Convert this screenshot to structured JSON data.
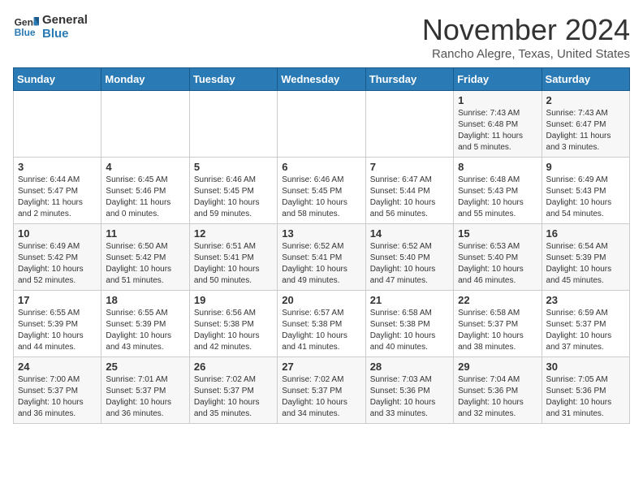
{
  "logo": {
    "line1": "General",
    "line2": "Blue"
  },
  "header": {
    "month": "November 2024",
    "location": "Rancho Alegre, Texas, United States"
  },
  "days_of_week": [
    "Sunday",
    "Monday",
    "Tuesday",
    "Wednesday",
    "Thursday",
    "Friday",
    "Saturday"
  ],
  "weeks": [
    [
      {
        "day": "",
        "info": ""
      },
      {
        "day": "",
        "info": ""
      },
      {
        "day": "",
        "info": ""
      },
      {
        "day": "",
        "info": ""
      },
      {
        "day": "",
        "info": ""
      },
      {
        "day": "1",
        "info": "Sunrise: 7:43 AM\nSunset: 6:48 PM\nDaylight: 11 hours\nand 5 minutes."
      },
      {
        "day": "2",
        "info": "Sunrise: 7:43 AM\nSunset: 6:47 PM\nDaylight: 11 hours\nand 3 minutes."
      }
    ],
    [
      {
        "day": "3",
        "info": "Sunrise: 6:44 AM\nSunset: 5:47 PM\nDaylight: 11 hours\nand 2 minutes."
      },
      {
        "day": "4",
        "info": "Sunrise: 6:45 AM\nSunset: 5:46 PM\nDaylight: 11 hours\nand 0 minutes."
      },
      {
        "day": "5",
        "info": "Sunrise: 6:46 AM\nSunset: 5:45 PM\nDaylight: 10 hours\nand 59 minutes."
      },
      {
        "day": "6",
        "info": "Sunrise: 6:46 AM\nSunset: 5:45 PM\nDaylight: 10 hours\nand 58 minutes."
      },
      {
        "day": "7",
        "info": "Sunrise: 6:47 AM\nSunset: 5:44 PM\nDaylight: 10 hours\nand 56 minutes."
      },
      {
        "day": "8",
        "info": "Sunrise: 6:48 AM\nSunset: 5:43 PM\nDaylight: 10 hours\nand 55 minutes."
      },
      {
        "day": "9",
        "info": "Sunrise: 6:49 AM\nSunset: 5:43 PM\nDaylight: 10 hours\nand 54 minutes."
      }
    ],
    [
      {
        "day": "10",
        "info": "Sunrise: 6:49 AM\nSunset: 5:42 PM\nDaylight: 10 hours\nand 52 minutes."
      },
      {
        "day": "11",
        "info": "Sunrise: 6:50 AM\nSunset: 5:42 PM\nDaylight: 10 hours\nand 51 minutes."
      },
      {
        "day": "12",
        "info": "Sunrise: 6:51 AM\nSunset: 5:41 PM\nDaylight: 10 hours\nand 50 minutes."
      },
      {
        "day": "13",
        "info": "Sunrise: 6:52 AM\nSunset: 5:41 PM\nDaylight: 10 hours\nand 49 minutes."
      },
      {
        "day": "14",
        "info": "Sunrise: 6:52 AM\nSunset: 5:40 PM\nDaylight: 10 hours\nand 47 minutes."
      },
      {
        "day": "15",
        "info": "Sunrise: 6:53 AM\nSunset: 5:40 PM\nDaylight: 10 hours\nand 46 minutes."
      },
      {
        "day": "16",
        "info": "Sunrise: 6:54 AM\nSunset: 5:39 PM\nDaylight: 10 hours\nand 45 minutes."
      }
    ],
    [
      {
        "day": "17",
        "info": "Sunrise: 6:55 AM\nSunset: 5:39 PM\nDaylight: 10 hours\nand 44 minutes."
      },
      {
        "day": "18",
        "info": "Sunrise: 6:55 AM\nSunset: 5:39 PM\nDaylight: 10 hours\nand 43 minutes."
      },
      {
        "day": "19",
        "info": "Sunrise: 6:56 AM\nSunset: 5:38 PM\nDaylight: 10 hours\nand 42 minutes."
      },
      {
        "day": "20",
        "info": "Sunrise: 6:57 AM\nSunset: 5:38 PM\nDaylight: 10 hours\nand 41 minutes."
      },
      {
        "day": "21",
        "info": "Sunrise: 6:58 AM\nSunset: 5:38 PM\nDaylight: 10 hours\nand 40 minutes."
      },
      {
        "day": "22",
        "info": "Sunrise: 6:58 AM\nSunset: 5:37 PM\nDaylight: 10 hours\nand 38 minutes."
      },
      {
        "day": "23",
        "info": "Sunrise: 6:59 AM\nSunset: 5:37 PM\nDaylight: 10 hours\nand 37 minutes."
      }
    ],
    [
      {
        "day": "24",
        "info": "Sunrise: 7:00 AM\nSunset: 5:37 PM\nDaylight: 10 hours\nand 36 minutes."
      },
      {
        "day": "25",
        "info": "Sunrise: 7:01 AM\nSunset: 5:37 PM\nDaylight: 10 hours\nand 36 minutes."
      },
      {
        "day": "26",
        "info": "Sunrise: 7:02 AM\nSunset: 5:37 PM\nDaylight: 10 hours\nand 35 minutes."
      },
      {
        "day": "27",
        "info": "Sunrise: 7:02 AM\nSunset: 5:37 PM\nDaylight: 10 hours\nand 34 minutes."
      },
      {
        "day": "28",
        "info": "Sunrise: 7:03 AM\nSunset: 5:36 PM\nDaylight: 10 hours\nand 33 minutes."
      },
      {
        "day": "29",
        "info": "Sunrise: 7:04 AM\nSunset: 5:36 PM\nDaylight: 10 hours\nand 32 minutes."
      },
      {
        "day": "30",
        "info": "Sunrise: 7:05 AM\nSunset: 5:36 PM\nDaylight: 10 hours\nand 31 minutes."
      }
    ]
  ]
}
